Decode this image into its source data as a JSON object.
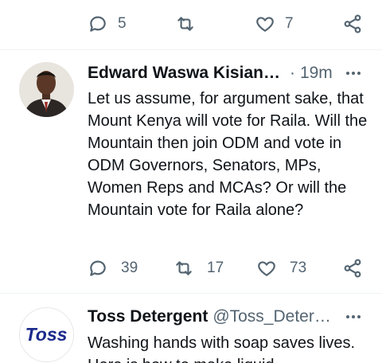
{
  "top_actions": {
    "reply_count": "5",
    "retweet_count": "",
    "like_count": "7"
  },
  "tweet1": {
    "author": "Edward Waswa Kisian…",
    "separator": "·",
    "time": "19m",
    "text": "Let us assume, for argument sake, that Mount Kenya will vote for Raila. Will the Mountain then join ODM and vote in ODM Governors, Senators, MPs, Women Reps and MCAs? Or will the Mountain vote for Raila alone?",
    "reply_count": "39",
    "retweet_count": "17",
    "like_count": "73"
  },
  "tweet2": {
    "author": "Toss Detergent",
    "handle": "@Toss_Deter…",
    "logo_text": "Toss",
    "text": "Washing hands with soap saves lives. Here is how to make liquid"
  },
  "colors": {
    "text_primary": "#0f1419",
    "text_secondary": "#536471",
    "divider": "#eff3f4",
    "toss_blue": "#1b2a8c"
  },
  "icons": [
    "reply-icon",
    "retweet-icon",
    "like-icon",
    "share-icon",
    "more-icon"
  ]
}
